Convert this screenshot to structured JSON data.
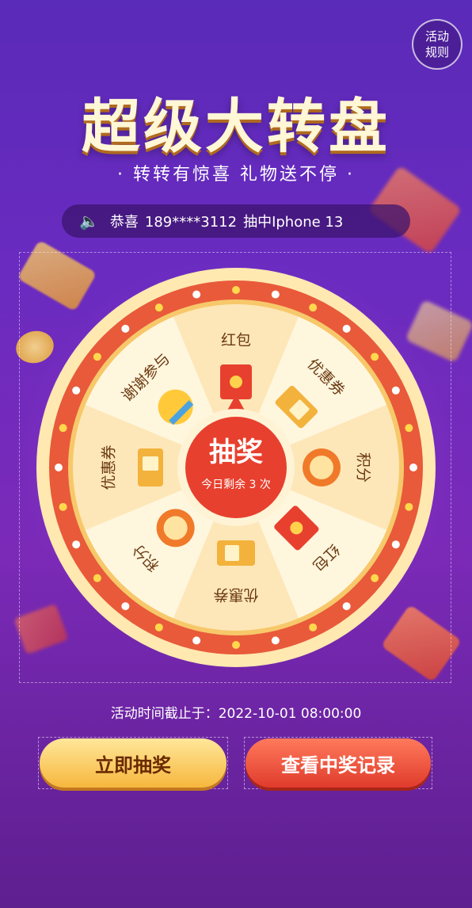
{
  "header": {
    "rules_line1": "活动",
    "rules_line2": "规则",
    "title": "超级大转盘",
    "subtitle": "· 转转有惊喜  礼物送不停 ·"
  },
  "notice": {
    "prefix": "恭喜",
    "phone": "189****3112",
    "text": "抽中Iphone 13"
  },
  "wheel": {
    "prizes": [
      "红包",
      "优惠券",
      "积分",
      "红包",
      "优惠券",
      "积分",
      "优惠券",
      "谢谢参与"
    ],
    "prize_icons": [
      "red-envelope-icon",
      "coupon-icon",
      "points-coin-icon",
      "red-envelope-icon",
      "coupon-icon",
      "points-coin-icon",
      "coupon-icon",
      "crying-face-icon"
    ],
    "center_label": "抽奖",
    "center_sub": "今日剩余 3 次",
    "colors": {
      "ring": "#e85a3a",
      "slice_light": "#fff6de",
      "slice_dark": "#fde7b8",
      "center": "#e8402e"
    }
  },
  "footer": {
    "deadline": "活动时间截止于：2022-10-01 08:00:00",
    "draw_button": "立即抽奖",
    "records_button": "查看中奖记录"
  }
}
